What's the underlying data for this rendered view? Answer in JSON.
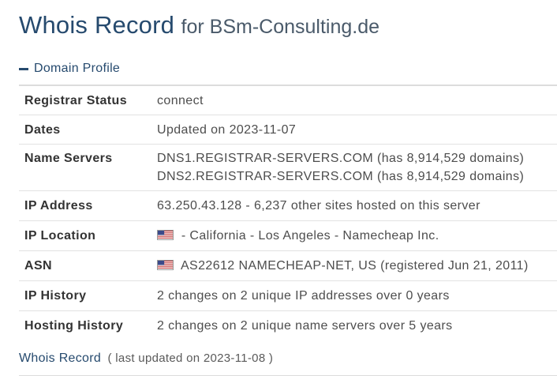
{
  "header": {
    "title": "Whois Record",
    "subtitle": "for BSm-Consulting.de"
  },
  "section": {
    "label": "Domain Profile",
    "toggle_icon": "minus-icon"
  },
  "profile": {
    "registrar_status": {
      "label": "Registrar Status",
      "value": "connect"
    },
    "dates": {
      "label": "Dates",
      "value": "Updated on 2023-11-07"
    },
    "name_servers": {
      "label": "Name Servers",
      "values": [
        "DNS1.REGISTRAR-SERVERS.COM (has 8,914,529 domains)",
        "DNS2.REGISTRAR-SERVERS.COM (has 8,914,529 domains)"
      ]
    },
    "ip_address": {
      "label": "IP Address",
      "value": "63.250.43.128 - 6,237 other sites hosted on this server"
    },
    "ip_location": {
      "label": "IP Location",
      "value": "- California - Los Angeles - Namecheap Inc.",
      "flag_icon": "us-flag-icon"
    },
    "asn": {
      "label": "ASN",
      "value": "AS22612 NAMECHEAP-NET, US (registered Jun 21, 2011)",
      "flag_icon": "us-flag-icon"
    },
    "ip_history": {
      "label": "IP History",
      "value": "2 changes on 2 unique IP addresses over 0 years"
    },
    "hosting_history": {
      "label": "Hosting History",
      "value": "2 changes on 2 unique name servers over 5 years"
    }
  },
  "whois_record": {
    "title": "Whois Record",
    "updated": "( last updated on 2023-11-08 )"
  },
  "colors": {
    "heading": "#264a6e",
    "text": "#4d4d4d",
    "divider": "#e2e2e2"
  }
}
